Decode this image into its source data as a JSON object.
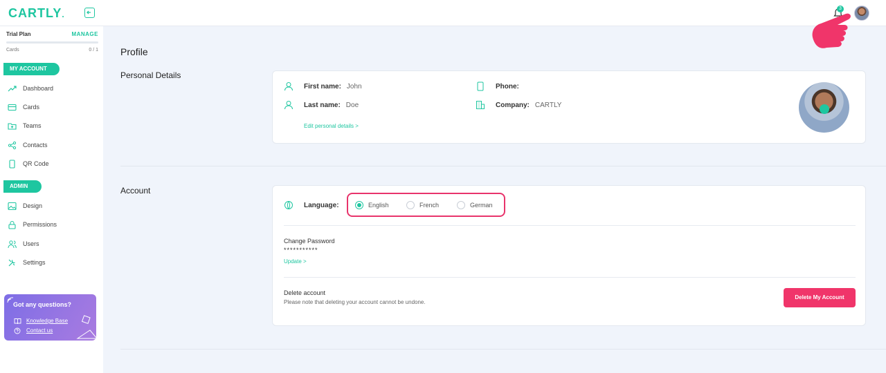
{
  "app": {
    "logo_text": "CARTLY",
    "accent": "#1ec6a0",
    "danger": "#f0356a"
  },
  "topbar": {
    "notification_count": "3"
  },
  "sidebar": {
    "plan": {
      "name": "Trial Plan",
      "manage": "MANAGE",
      "cards_label": "Cards",
      "cards_count": "0 / 1"
    },
    "sections": {
      "my_account": "MY ACCOUNT",
      "admin": "ADMIN"
    },
    "my_account_items": [
      {
        "label": "Dashboard",
        "icon": "trending-up-icon"
      },
      {
        "label": "Cards",
        "icon": "card-icon"
      },
      {
        "label": "Teams",
        "icon": "folder-plus-icon"
      },
      {
        "label": "Contacts",
        "icon": "share-icon"
      },
      {
        "label": "QR Code",
        "icon": "phone-icon"
      }
    ],
    "admin_items": [
      {
        "label": "Design",
        "icon": "image-icon"
      },
      {
        "label": "Permissions",
        "icon": "lock-icon"
      },
      {
        "label": "Users",
        "icon": "users-icon"
      },
      {
        "label": "Settings",
        "icon": "tools-icon"
      }
    ],
    "help": {
      "title": "Got any questions?",
      "knowledge_base": "Knowledge Base",
      "contact": "Contact us"
    }
  },
  "main": {
    "page_title": "Profile",
    "personal": {
      "section_title": "Personal Details",
      "first_name_label": "First name:",
      "first_name": "John",
      "last_name_label": "Last name:",
      "last_name": "Doe",
      "phone_label": "Phone:",
      "phone": "",
      "company_label": "Company:",
      "company": "CARTLY",
      "edit_link": "Edit personal details >"
    },
    "account": {
      "section_title": "Account",
      "language_label": "Language:",
      "languages": [
        "English",
        "French",
        "German"
      ],
      "selected_language": "English",
      "change_password_title": "Change Password",
      "password_mask": "***********",
      "update_link": "Update >",
      "delete_title": "Delete account",
      "delete_note": "Please note that deleting your account cannot be undone.",
      "delete_button": "Delete My Account"
    }
  }
}
